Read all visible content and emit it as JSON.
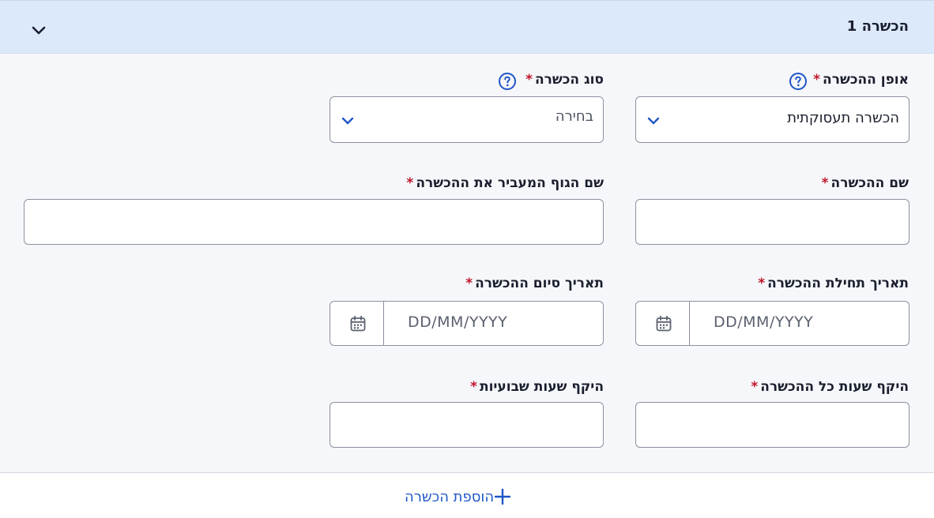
{
  "panel": {
    "title": "הכשרה 1",
    "collapse_icon": "chevron-down-icon"
  },
  "fields": {
    "training_mode": {
      "label": "אופן ההכשרה",
      "required_mark": "*",
      "help_icon": "help-circle-icon",
      "value": "הכשרה תעסוקתית"
    },
    "training_type": {
      "label": "סוג הכשרה",
      "required_mark": "*",
      "help_icon": "help-circle-icon",
      "placeholder": "בחירה"
    },
    "training_name": {
      "label": "שם ההכשרה",
      "required_mark": "*",
      "value": ""
    },
    "provider_name": {
      "label": "שם הגוף המעביר את ההכשרה",
      "required_mark": "*",
      "value": ""
    },
    "start_date": {
      "label": "תאריך תחילת ההכשרה",
      "required_mark": "*",
      "placeholder": "DD/MM/YYYY",
      "icon": "calendar-icon"
    },
    "end_date": {
      "label": "תאריך סיום ההכשרה",
      "required_mark": "*",
      "placeholder": "DD/MM/YYYY",
      "icon": "calendar-icon"
    },
    "total_hours": {
      "label": "היקף שעות כל ההכשרה",
      "required_mark": "*",
      "value": ""
    },
    "weekly_hours": {
      "label": "היקף שעות שבועיות",
      "required_mark": "*",
      "value": ""
    }
  },
  "footer": {
    "add_label": "הוספת הכשרה",
    "add_icon": "plus-icon"
  },
  "colors": {
    "header_bg": "#dce9fb",
    "accent": "#1f56c7",
    "required": "#c0162b"
  }
}
